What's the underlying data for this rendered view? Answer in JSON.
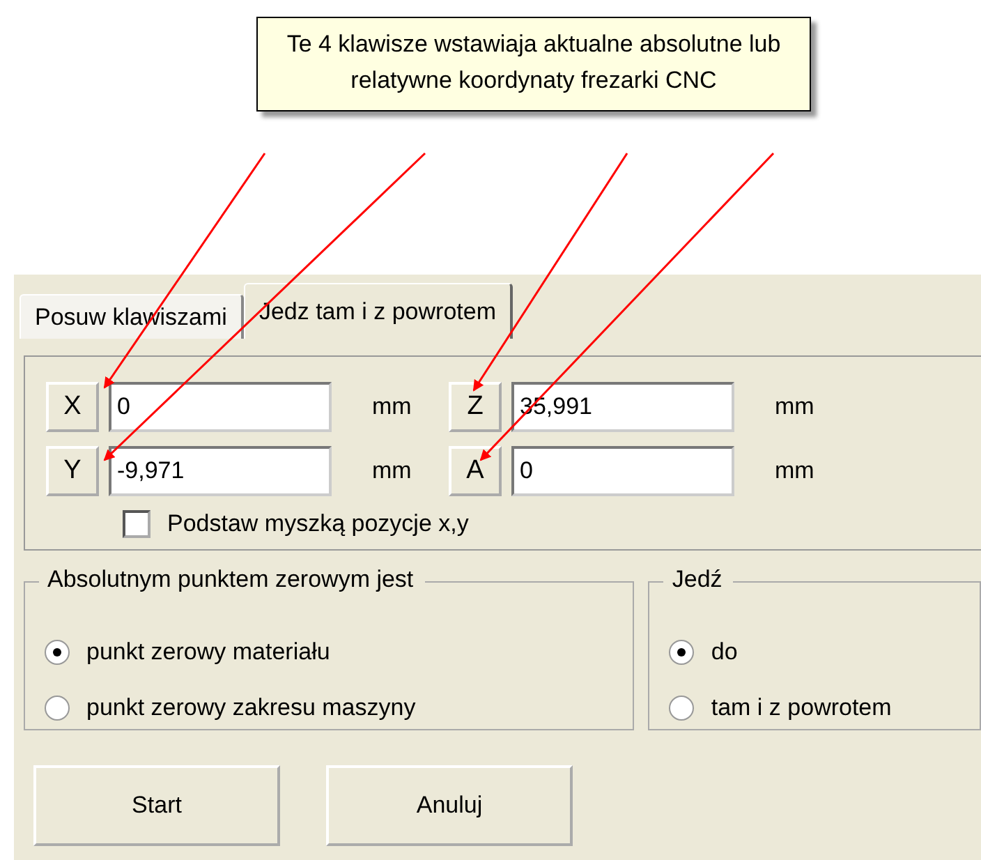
{
  "callout": {
    "text": "Te 4 klawisze wstawiaja aktualne absolutne lub relatywne koordynaty frezarki CNC"
  },
  "tabs": [
    {
      "label": "Posuw klawiszami",
      "selected": false
    },
    {
      "label": "Jedz tam i z powrotem",
      "selected": true
    }
  ],
  "axes": [
    {
      "key": "X",
      "value": "0",
      "unit": "mm"
    },
    {
      "key": "Z",
      "value": "35,991",
      "unit": "mm"
    },
    {
      "key": "Y",
      "value": "-9,971",
      "unit": "mm"
    },
    {
      "key": "A",
      "value": "0",
      "unit": "mm"
    }
  ],
  "mouse_checkbox": {
    "label": "Podstaw myszką pozycje x,y",
    "checked": false
  },
  "groups": [
    {
      "title": "Absolutnym punktem zerowym jest",
      "options": [
        {
          "label": "punkt zerowy materiału",
          "selected": true
        },
        {
          "label": "punkt zerowy zakresu maszyny",
          "selected": false
        }
      ]
    },
    {
      "title": "Jedź",
      "options": [
        {
          "label": "do",
          "selected": true
        },
        {
          "label": "tam i z powrotem",
          "selected": false
        }
      ]
    }
  ],
  "buttons": [
    "Start",
    "Anuluj"
  ]
}
